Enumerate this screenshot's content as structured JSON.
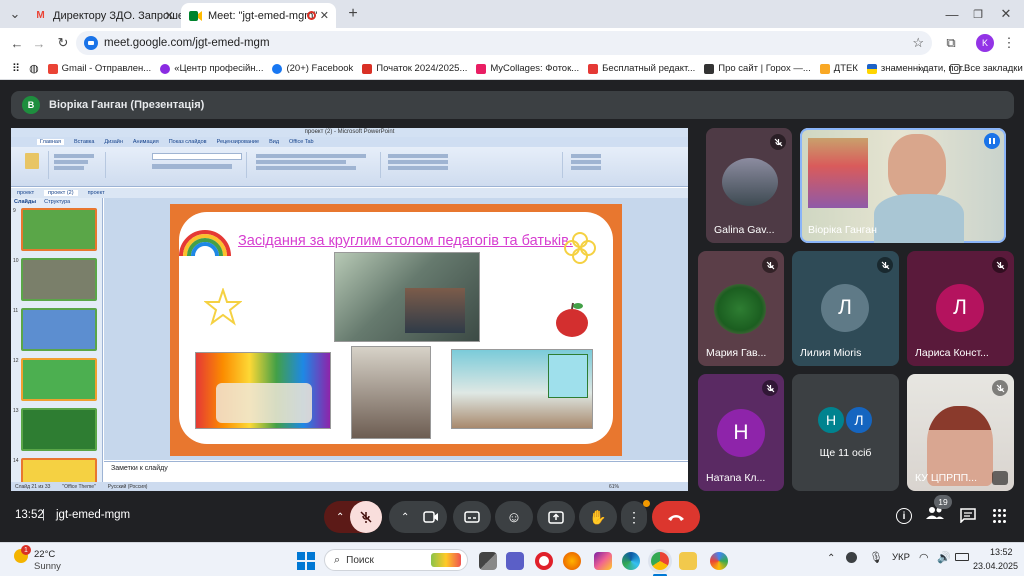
{
  "tabs": [
    {
      "title": "Директору ЗДО. Запрошення на...",
      "favicon": "gmail-icon"
    },
    {
      "title": "Meet: \"jgt-emed-mgm\"",
      "favicon": "meet-icon",
      "active": true
    }
  ],
  "address": {
    "url": "meet.google.com/jgt-emed-mgm"
  },
  "profile_initial": "K",
  "bookmarks": [
    {
      "label": "Gmail - Отправлен...",
      "color": "#ea4335"
    },
    {
      "label": "«Центр професійн...",
      "color": "#8a2be2"
    },
    {
      "label": "(20+) Facebook",
      "color": "#1877f2"
    },
    {
      "label": "Початок 2024/2025...",
      "color": "#d93025"
    },
    {
      "label": "MyCollages: Фоток...",
      "color": "#e91e63"
    },
    {
      "label": "Бесплатный редакт...",
      "color": "#e53935"
    },
    {
      "label": "Про сайт | Горох —...",
      "color": "#333333"
    },
    {
      "label": "ДТЕК",
      "color": "#f9a825"
    },
    {
      "label": "знаменні дати, пот...",
      "color": "#1e63c8"
    }
  ],
  "bookmarks_all": "Все закладки",
  "presenter_bar": {
    "initial": "В",
    "label": "Віоріка Ганган (Презентація)"
  },
  "ppt": {
    "window_title": "проект (2) - Microsoft PowerPoint",
    "ribbon_tabs": [
      "Главная",
      "Вставка",
      "Дизайн",
      "Анимация",
      "Показ слайдов",
      "Рецензирование",
      "Вид",
      "Office Tab"
    ],
    "doc_tabs": [
      "проект",
      "проект (2)",
      "проект"
    ],
    "panel_tabs": [
      "Слайды",
      "Структура"
    ],
    "slide_title": "Засідання  за круглим столом  педагогів та батьків.",
    "notes_placeholder": "Заметки к слайду",
    "status": "Слайд 21 из 33",
    "theme": "\"Office Theme\"",
    "lang": "Русский (Россия)",
    "zoom": "61%",
    "thumb_numbers": [
      "9",
      "10",
      "11",
      "12",
      "13",
      "14"
    ]
  },
  "participants": [
    {
      "name": "Galina Gav...",
      "type": "video",
      "muted": true
    },
    {
      "name": "Віоріка Ганган",
      "type": "video",
      "speaking": true
    },
    {
      "name": "Мария Гав...",
      "type": "image",
      "muted": true
    },
    {
      "name": "Лилия Miоris",
      "initial": "Л",
      "color": "#5f7a87",
      "muted": true
    },
    {
      "name": "Лариса Конст...",
      "initial": "Л",
      "color": "#b4135e",
      "muted": true
    },
    {
      "name": "Натаnа Кл...",
      "initial": "Н",
      "color": "#8e24aa",
      "muted": true
    },
    {
      "name": "Ще 11 осіб",
      "initials": [
        "Н",
        "Л"
      ]
    },
    {
      "name": "КУ ЦПРПП...",
      "type": "video",
      "muted": true
    }
  ],
  "meeting": {
    "time": "13:52",
    "code": "jgt-emed-mgm",
    "people_count": "19"
  },
  "taskbar": {
    "temp": "22°C",
    "weather": "Sunny",
    "weather_badge": "1",
    "search": "Поиск",
    "lang": "УКР",
    "time": "13:52",
    "date": "23.04.2025"
  }
}
